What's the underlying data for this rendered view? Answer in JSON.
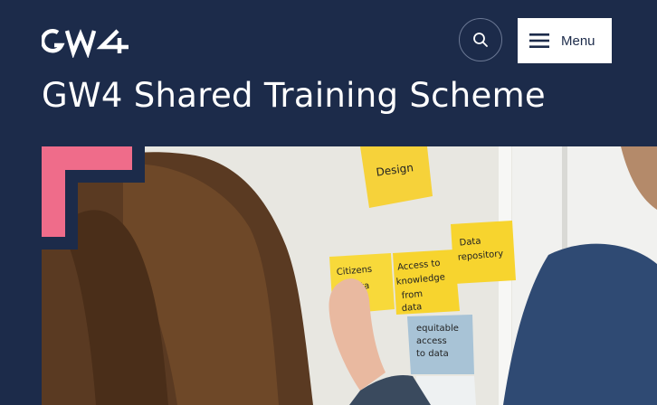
{
  "brand": {
    "logo_text": "GW4"
  },
  "header": {
    "search_icon": "search-icon",
    "menu_icon": "hamburger-icon",
    "menu_label": "Menu"
  },
  "page": {
    "title": "GW4 Shared Training Scheme"
  },
  "hero": {
    "image_description_hidden": "",
    "notes": [
      {
        "text": "Design"
      },
      {
        "text": "Data repository"
      },
      {
        "text": "Access to knowledge from data"
      },
      {
        "text": "Citizens data"
      },
      {
        "text": "equitable access to data"
      }
    ]
  },
  "colors": {
    "header_bg": "#1c2b4a",
    "accent_pink": "#ef6c8a",
    "white": "#ffffff"
  }
}
